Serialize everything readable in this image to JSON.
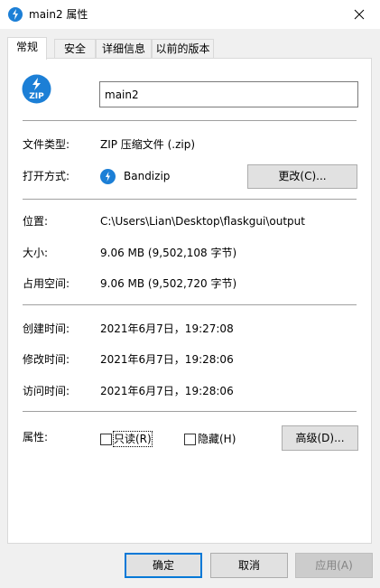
{
  "window": {
    "title": "main2 属性",
    "close_glyph": "✕"
  },
  "tabs": [
    {
      "label": "常规",
      "active": true
    },
    {
      "label": "安全",
      "active": false
    },
    {
      "label": "详细信息",
      "active": false
    },
    {
      "label": "以前的版本",
      "active": false
    }
  ],
  "general": {
    "file_icon": "zip-icon",
    "file_icon_text": "ZIP",
    "name_value": "main2",
    "file_type_label": "文件类型:",
    "file_type_value": "ZIP 压缩文件 (.zip)",
    "open_with_label": "打开方式:",
    "open_with_app": "Bandizip",
    "change_button": "更改(C)...",
    "location_label": "位置:",
    "location_value": "C:\\Users\\Lian\\Desktop\\flaskgui\\output",
    "size_label": "大小:",
    "size_value": "9.06 MB (9,502,108 字节)",
    "size_on_disk_label": "占用空间:",
    "size_on_disk_value": "9.06 MB (9,502,720 字节)",
    "created_label": "创建时间:",
    "created_value": "2021年6月7日，19:27:08",
    "modified_label": "修改时间:",
    "modified_value": "2021年6月7日，19:28:06",
    "accessed_label": "访问时间:",
    "accessed_value": "2021年6月7日，19:28:06",
    "attributes_label": "属性:",
    "readonly_label": "只读(R)",
    "readonly_checked": false,
    "hidden_label": "隐藏(H)",
    "hidden_checked": false,
    "advanced_button": "高级(D)..."
  },
  "footer": {
    "ok_button": "确定",
    "cancel_button": "取消",
    "apply_button": "应用(A)"
  },
  "colors": {
    "accent": "#0078d7",
    "zip_icon_blue": "#1c7fd6"
  }
}
